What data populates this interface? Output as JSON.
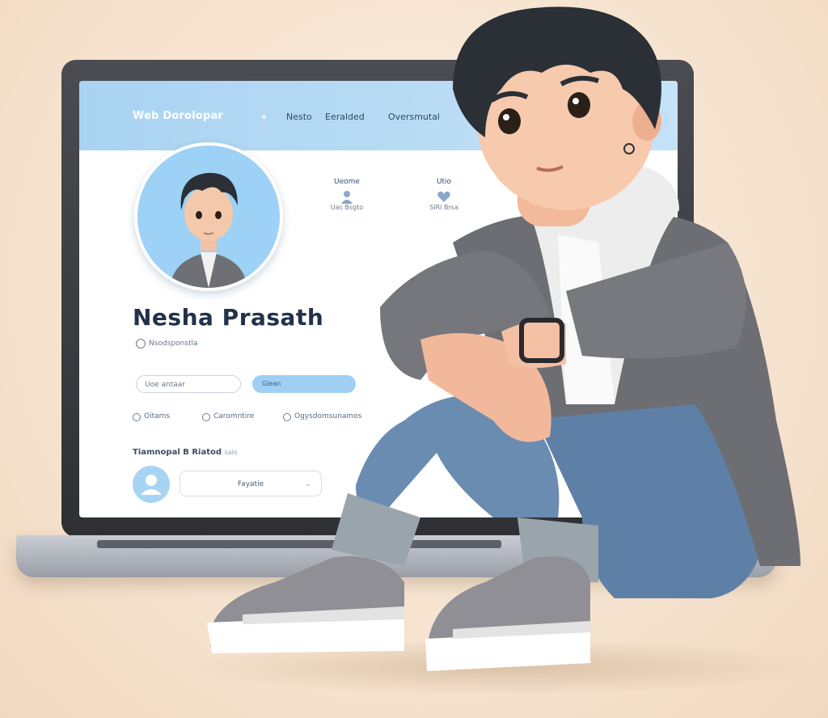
{
  "screen": {
    "brand": "Web Dorolopar",
    "nav": [
      "Nesto",
      "Eeralded",
      "Oversmutal"
    ],
    "stats": [
      {
        "label": "Ueome",
        "value": "Uas Bsgto",
        "icon": "person-icon"
      },
      {
        "label": "Utio",
        "value": "SIRI Brsa",
        "icon": "heart-icon"
      }
    ],
    "name": "Nesha Prasath",
    "subtitle": "Nsodsponstla",
    "input_placeholder": "Uoe antaar",
    "button_label": "Glean",
    "radios": [
      "Oitams",
      "Caromntire",
      "Ogysdomsunamos"
    ],
    "section_title": "Tiamnopal B Riatod",
    "section_note": "salo",
    "select_value": "Fayatie"
  },
  "colors": {
    "background": "#f6e3cf",
    "header": "#a9d3f2",
    "accent": "#9fd0f4",
    "name_text": "#23324a",
    "jacket": "#6f6f73",
    "jeans": "#5b7da3",
    "hair": "#2b2f36"
  }
}
